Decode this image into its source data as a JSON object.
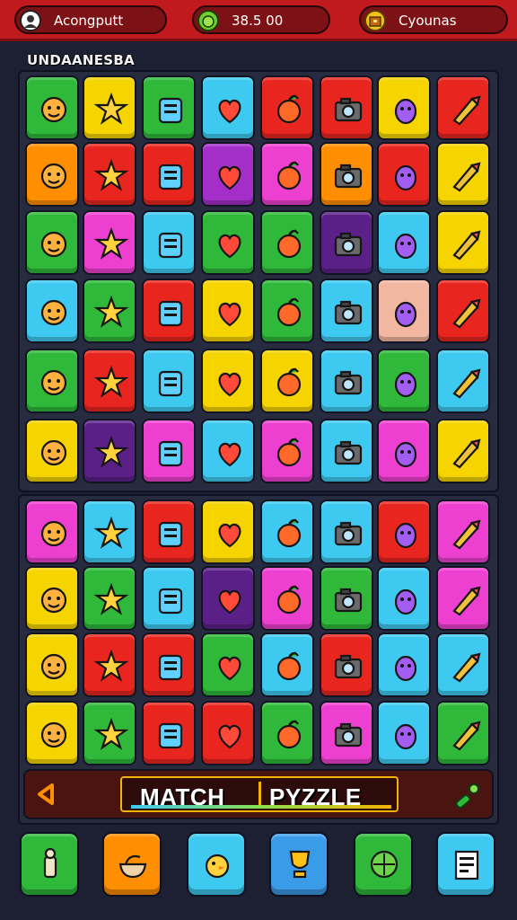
{
  "topbar": {
    "account_label": "Acongputt",
    "score_label": "38.5 00",
    "coins_label": "Cyounas"
  },
  "board": {
    "title": "UNDAANESBA",
    "tiles": [
      {
        "bg": "#2fb83a",
        "icon": "pencil-icon"
      },
      {
        "bg": "#f5d400",
        "icon": "berries-icon"
      },
      {
        "bg": "#2fb83a",
        "icon": "robot-face-icon"
      },
      {
        "bg": "#3ec9f0",
        "icon": "battery-icon"
      },
      {
        "bg": "#e8261f",
        "icon": "smile-face-icon"
      },
      {
        "bg": "#e8261f",
        "icon": "alien-icon"
      },
      {
        "bg": "#f5d400",
        "icon": "leaf-icon"
      },
      {
        "bg": "#e8261f",
        "icon": "blob-icon"
      },
      {
        "bg": "#ff8f00",
        "icon": "ball-icon"
      },
      {
        "bg": "#e8261f",
        "icon": "star-icon"
      },
      {
        "bg": "#e8261f",
        "icon": "orange-ball-icon"
      },
      {
        "bg": "#a42fc8",
        "icon": "gift-icon"
      },
      {
        "bg": "#ee40d0",
        "icon": "camera-icon"
      },
      {
        "bg": "#ff8f00",
        "icon": "lightning-icon"
      },
      {
        "bg": "#e8261f",
        "icon": "apple-icon"
      },
      {
        "bg": "#f5d400",
        "icon": "face-icon"
      },
      {
        "bg": "#2fb83a",
        "icon": "bug-icon"
      },
      {
        "bg": "#ee40d0",
        "icon": "lemon-face-icon"
      },
      {
        "bg": "#3ec9f0",
        "icon": "radio-icon"
      },
      {
        "bg": "#2fb83a",
        "icon": "notepad-icon"
      },
      {
        "bg": "#2fb83a",
        "icon": "frame-icon"
      },
      {
        "bg": "#5a2088",
        "icon": "sausage-icon"
      },
      {
        "bg": "#3ec9f0",
        "icon": "orange-face-icon"
      },
      {
        "bg": "#f5d400",
        "icon": "wallet-icon"
      },
      {
        "bg": "#3ec9f0",
        "icon": "bag-icon"
      },
      {
        "bg": "#2fb83a",
        "icon": "glove-icon"
      },
      {
        "bg": "#e8261f",
        "icon": "eggplant-icon"
      },
      {
        "bg": "#f5d400",
        "icon": "balloon-icon"
      },
      {
        "bg": "#2fb83a",
        "icon": "microphone-icon"
      },
      {
        "bg": "#3ec9f0",
        "icon": "heart-icon"
      },
      {
        "bg": "#f2b7a0",
        "icon": "turtle-icon"
      },
      {
        "bg": "#e8261f",
        "icon": "document-icon"
      },
      {
        "bg": "#2fb83a",
        "icon": "plane-icon"
      },
      {
        "bg": "#e8261f",
        "icon": "heart-face-icon"
      },
      {
        "bg": "#3ec9f0",
        "icon": "fruit-icon"
      },
      {
        "bg": "#f5d400",
        "icon": "sun-face-icon"
      },
      {
        "bg": "#f5d400",
        "icon": "tomato-icon"
      },
      {
        "bg": "#3ec9f0",
        "icon": "screwdriver-icon"
      },
      {
        "bg": "#2fb83a",
        "icon": "tv-icon"
      },
      {
        "bg": "#3ec9f0",
        "icon": "sunflower-icon"
      },
      {
        "bg": "#f5d400",
        "icon": "battery-green-icon"
      },
      {
        "bg": "#5a2088",
        "icon": "sun-icon"
      },
      {
        "bg": "#ee40d0",
        "icon": "blue-bomb-icon"
      },
      {
        "bg": "#3ec9f0",
        "icon": "bottle-icon"
      },
      {
        "bg": "#ee40d0",
        "icon": "card-icon"
      },
      {
        "bg": "#3ec9f0",
        "icon": "cat-icon"
      },
      {
        "bg": "#ee40d0",
        "icon": "gear-icon"
      },
      {
        "bg": "#f5d400",
        "icon": "red-apple-icon"
      },
      {
        "bg": "#ee40d0",
        "icon": "ghost-icon"
      },
      {
        "bg": "#3ec9f0",
        "icon": "cone-icon"
      },
      {
        "bg": "#e8261f",
        "icon": "orange-fruit-icon"
      },
      {
        "bg": "#f5d400",
        "icon": "jar-icon"
      },
      {
        "bg": "#3ec9f0",
        "icon": "swirl-icon"
      },
      {
        "bg": "#3ec9f0",
        "icon": "bell-icon"
      },
      {
        "bg": "#e8261f",
        "icon": "pumpkin-icon"
      },
      {
        "bg": "#ee40d0",
        "icon": "fox-icon"
      },
      {
        "bg": "#f5d400",
        "icon": "popsicle-icon"
      },
      {
        "bg": "#2fb83a",
        "icon": "slime-icon"
      },
      {
        "bg": "#3ec9f0",
        "icon": "cake-icon"
      },
      {
        "bg": "#5a2088",
        "icon": "pig-icon"
      },
      {
        "bg": "#ee40d0",
        "icon": "note-icon"
      },
      {
        "bg": "#2fb83a",
        "icon": "cherry-icon"
      },
      {
        "bg": "#3ec9f0",
        "icon": "strawberry-icon"
      },
      {
        "bg": "#ee40d0",
        "icon": "brush-icon"
      },
      {
        "bg": "#f5d400",
        "icon": "helmet-icon"
      },
      {
        "bg": "#e8261f",
        "icon": "crown-icon"
      },
      {
        "bg": "#e8261f",
        "icon": "yellow-apple-icon"
      },
      {
        "bg": "#2fb83a",
        "icon": "green-smile-icon"
      },
      {
        "bg": "#3ec9f0",
        "icon": "baton-icon"
      },
      {
        "bg": "#e8261f",
        "icon": "banana-icon"
      },
      {
        "bg": "#3ec9f0",
        "icon": "fox-face-icon"
      },
      {
        "bg": "#3ec9f0",
        "icon": "bear-icon"
      },
      {
        "bg": "#f5d400",
        "icon": "tongs-icon"
      },
      {
        "bg": "#2fb83a",
        "icon": "tomato-face-icon"
      },
      {
        "bg": "#e8261f",
        "icon": "capsule-icon"
      },
      {
        "bg": "#e8261f",
        "icon": "phone-icon"
      },
      {
        "bg": "#2fb83a",
        "icon": "heart-apple-icon"
      },
      {
        "bg": "#ee40d0",
        "icon": "camera2-icon"
      },
      {
        "bg": "#3ec9f0",
        "icon": "briefcase-icon"
      },
      {
        "bg": "#2fb83a",
        "icon": "peach-icon"
      }
    ]
  },
  "match_bar": {
    "word1": "MATCH",
    "word2": "PYZZLE"
  },
  "nav": [
    {
      "bg": "#2fb83a",
      "icon": "chess-icon"
    },
    {
      "bg": "#ff8f00",
      "icon": "bowl-icon"
    },
    {
      "bg": "#3ec9f0",
      "icon": "chick-icon"
    },
    {
      "bg": "#3a9be8",
      "icon": "trophy-icon"
    },
    {
      "bg": "#2fb83a",
      "icon": "compass-icon"
    },
    {
      "bg": "#3ec9f0",
      "icon": "notes-icon"
    }
  ]
}
